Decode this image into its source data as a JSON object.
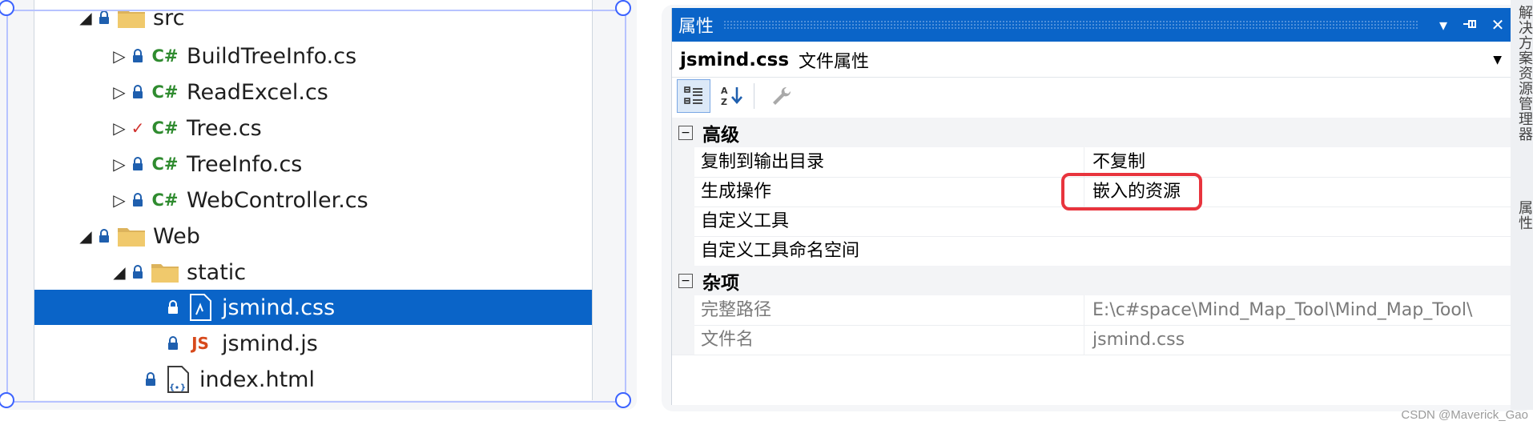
{
  "explorer": {
    "items": [
      {
        "label": "src",
        "kind": "folder",
        "expander": "open",
        "status": "lock"
      },
      {
        "label": "BuildTreeInfo.cs",
        "kind": "cs",
        "expander": "closed",
        "status": "lock"
      },
      {
        "label": "ReadExcel.cs",
        "kind": "cs",
        "expander": "closed",
        "status": "lock"
      },
      {
        "label": "Tree.cs",
        "kind": "cs",
        "expander": "closed",
        "status": "check"
      },
      {
        "label": "TreeInfo.cs",
        "kind": "cs",
        "expander": "closed",
        "status": "lock"
      },
      {
        "label": "WebController.cs",
        "kind": "cs",
        "expander": "closed",
        "status": "lock"
      },
      {
        "label": "Web",
        "kind": "folder",
        "expander": "open",
        "status": "lock"
      },
      {
        "label": "static",
        "kind": "folder",
        "expander": "open",
        "status": "lock"
      },
      {
        "label": "jsmind.css",
        "kind": "css",
        "expander": "none",
        "status": "lock",
        "selected": true
      },
      {
        "label": "jsmind.js",
        "kind": "js",
        "expander": "none",
        "status": "lock"
      },
      {
        "label": "index.html",
        "kind": "html",
        "expander": "none",
        "status": "lock"
      }
    ],
    "icon_text": {
      "cs": "C#",
      "js": "JS"
    }
  },
  "properties": {
    "title": "属性",
    "object_name": "jsmind.css",
    "object_type": "文件属性",
    "categories": [
      {
        "name": "高级",
        "rows": [
          {
            "name": "复制到输出目录",
            "value": "不复制"
          },
          {
            "name": "生成操作",
            "value": "嵌入的资源",
            "highlighted": true
          },
          {
            "name": "自定义工具",
            "value": ""
          },
          {
            "name": "自定义工具命名空间",
            "value": ""
          }
        ]
      },
      {
        "name": "杂项",
        "rows": [
          {
            "name": "完整路径",
            "value": "E:\\c#space\\Mind_Map_Tool\\Mind_Map_Tool\\",
            "readonly": true
          },
          {
            "name": "文件名",
            "value": "jsmind.css",
            "readonly": true
          }
        ]
      }
    ]
  },
  "side_panel": {
    "text1": "解决方案资源管理器",
    "text2": "属性"
  },
  "watermark": "CSDN @Maverick_Gao",
  "colors": {
    "selection": "#0a64c8",
    "highlight": "#e8343d",
    "cs_icon": "#2f8b2f",
    "js_icon": "#d74a1c"
  }
}
